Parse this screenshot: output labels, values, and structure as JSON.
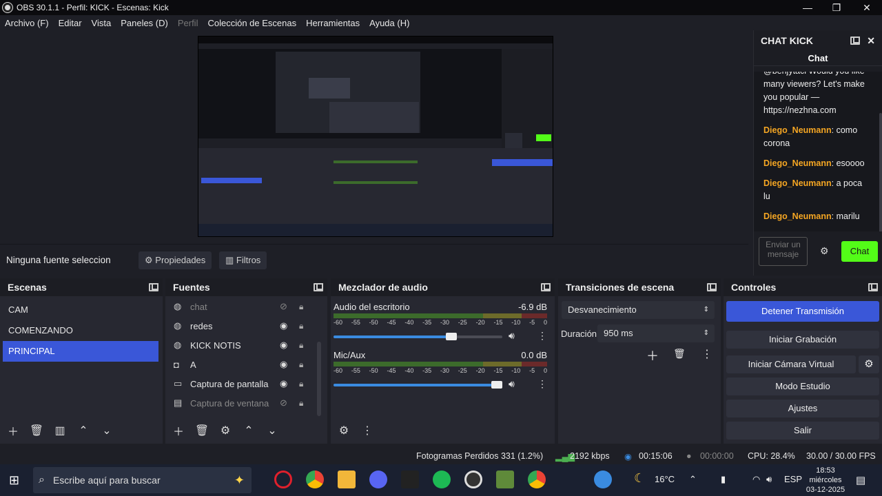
{
  "window": {
    "title": "OBS 30.1.1 - Perfil: KICK - Escenas: Kick"
  },
  "menu": [
    "Archivo (F)",
    "Editar",
    "Vista",
    "Paneles (D)",
    "Perfil",
    "Colección de Escenas",
    "Herramientas",
    "Ayuda (H)"
  ],
  "chat": {
    "dock_title": "CHAT KICK",
    "tab": "Chat",
    "partial_top": "@benjytaci Would you like many viewers? Let's make you popular — https://nezhna.com",
    "messages": [
      {
        "user": "Diego_Neumann",
        "text": ": como corona"
      },
      {
        "user": "Diego_Neumann",
        "text": ": esoooo"
      },
      {
        "user": "Diego_Neumann",
        "text": ": a poca lu"
      },
      {
        "user": "Diego_Neumann",
        "text": ": marilu"
      }
    ],
    "input_placeholder": "Enviar un mensaje",
    "send_label": "Chat",
    "accent": "#53fc18"
  },
  "sourcebar": {
    "selected": "Ninguna fuente seleccionada",
    "properties": "Propiedades",
    "filters": "Filtros"
  },
  "scenes": {
    "title": "Escenas",
    "items": [
      "CAM",
      "COMENZANDO",
      "PRINCIPAL"
    ],
    "selected": "PRINCIPAL"
  },
  "sources": {
    "title": "Fuentes",
    "items": [
      {
        "name": "chat",
        "icon": "browser-icon",
        "visible": false
      },
      {
        "name": "redes",
        "icon": "browser-icon",
        "visible": true
      },
      {
        "name": "KICK NOTIS",
        "icon": "browser-icon",
        "visible": true
      },
      {
        "name": "A",
        "icon": "camera-icon",
        "visible": true
      },
      {
        "name": "Captura de pantalla",
        "icon": "monitor-icon",
        "visible": true
      },
      {
        "name": "Captura de ventana",
        "icon": "window-icon",
        "visible": false
      }
    ]
  },
  "mixer": {
    "title": "Mezclador de audio",
    "channels": [
      {
        "name": "Audio del escritorio",
        "db": "-6.9 dB",
        "volume": 0.73
      },
      {
        "name": "Mic/Aux",
        "db": "0.0 dB",
        "volume": 1.0
      }
    ],
    "ticks": [
      "-60",
      "-55",
      "-50",
      "-45",
      "-40",
      "-35",
      "-30",
      "-25",
      "-20",
      "-15",
      "-10",
      "-5",
      "0"
    ]
  },
  "transitions": {
    "title": "Transiciones de escena",
    "type": "Desvanecimiento",
    "duration_label": "Duración",
    "duration": "950 ms"
  },
  "controls": {
    "title": "Controles",
    "stop_stream": "Detener Transmisión",
    "start_record": "Iniciar Grabación",
    "virtual_cam": "Iniciar Cámara Virtual",
    "studio_mode": "Modo Estudio",
    "settings": "Ajustes",
    "exit": "Salir"
  },
  "status": {
    "dropped": "Fotogramas Perdidos 331 (1.2%)",
    "bitrate": "2192 kbps",
    "stream_time": "00:15:06",
    "rec_time": "00:00:00",
    "cpu": "CPU: 28.4%",
    "fps": "30.00 / 30.00 FPS"
  },
  "taskbar": {
    "search_placeholder": "Escribe aquí para buscar",
    "temp": "16°C",
    "lang": "ESP",
    "time": "18:53",
    "day": "miércoles",
    "date": "03-12-2025"
  }
}
